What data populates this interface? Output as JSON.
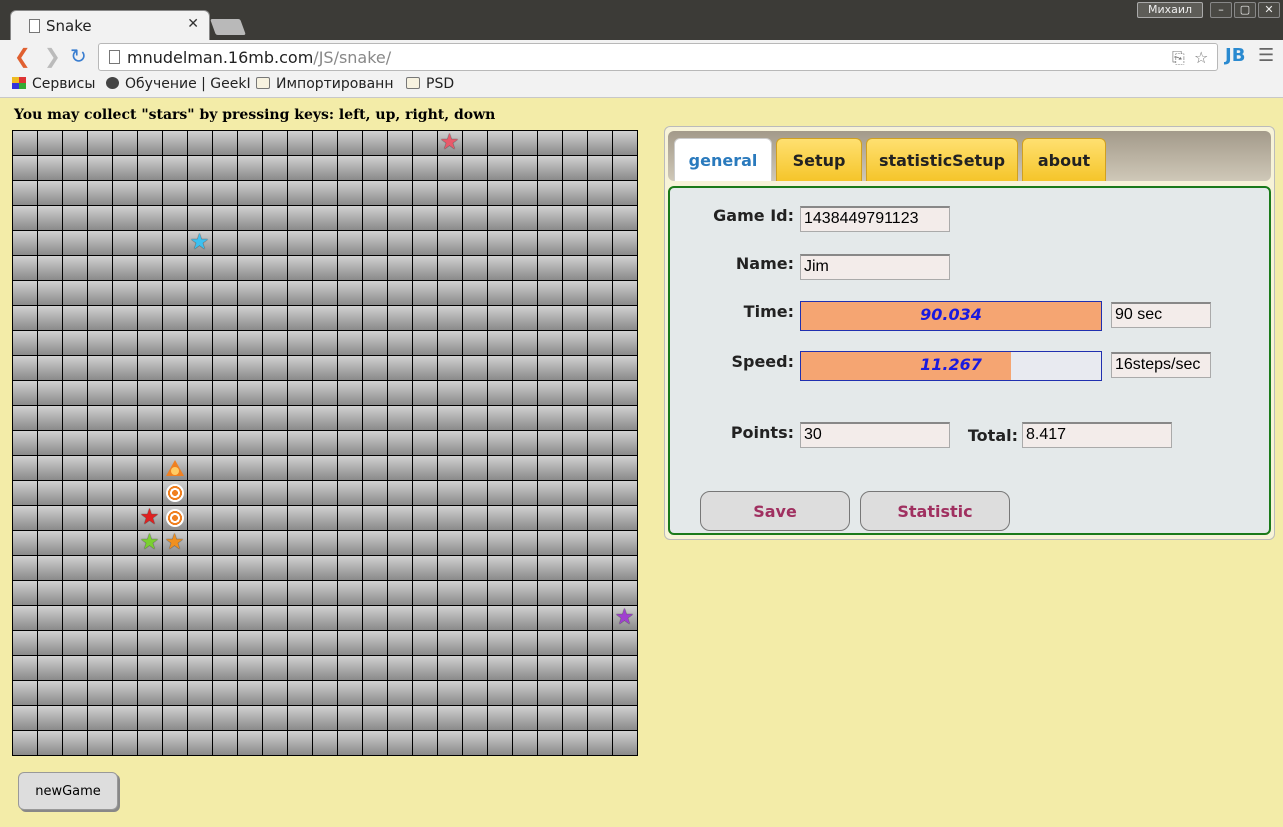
{
  "browser": {
    "tab_title": "Snake",
    "user_label": "Михаил",
    "url_host": "mnudelman.16mb.com",
    "url_path": "/JS/snake/",
    "bookmarks": [
      {
        "label": "Сервисы",
        "icon": "apps-grid-icon"
      },
      {
        "label": "Обучение | GeekI",
        "icon": "geekbrains-icon"
      },
      {
        "label": "Импортированн",
        "icon": "folder-icon"
      },
      {
        "label": "PSD",
        "icon": "folder-icon"
      }
    ]
  },
  "page": {
    "instructions": "You may collect \"stars\" by pressing keys: left, up, right, down",
    "newgame_label": "newGame"
  },
  "panel": {
    "tabs": [
      {
        "label": "general",
        "active": true
      },
      {
        "label": "Setup",
        "active": false
      },
      {
        "label": "statisticSetup",
        "active": false
      },
      {
        "label": "about",
        "active": false
      }
    ],
    "fields": {
      "game_id_label": "Game Id:",
      "game_id_value": "1438449791123",
      "name_label": "Name:",
      "name_value": "Jim",
      "time_label": "Time:",
      "time_progress": "90.034",
      "time_progress_fraction": 1.0,
      "time_value": "90 sec",
      "speed_label": "Speed:",
      "speed_progress": "11.267",
      "speed_progress_fraction": 0.7,
      "speed_value": "16steps/sec",
      "points_label": "Points:",
      "points_value": "30",
      "total_label": "Total:",
      "total_value": "8.417"
    },
    "save_label": "Save",
    "statistic_label": "Statistic"
  },
  "colors": {
    "page_bg": "#f3eca8",
    "tab_active_text": "#2a7abd",
    "tab_bg": "#f5c52a",
    "progress_fill": "#f5a572",
    "progress_text": "#1a1adf",
    "button_text": "#a03060",
    "content_border": "#1a7a1a"
  },
  "board": {
    "grid_size": 25,
    "items": [
      {
        "kind": "star",
        "color": "#e85a6a",
        "col": 17,
        "row": 0
      },
      {
        "kind": "star",
        "color": "#3cc0f0",
        "col": 7,
        "row": 4
      },
      {
        "kind": "snake-head",
        "col": 6,
        "row": 13
      },
      {
        "kind": "snake-segment",
        "col": 6,
        "row": 14
      },
      {
        "kind": "snake-segment",
        "col": 6,
        "row": 15
      },
      {
        "kind": "star",
        "color": "#e02020",
        "col": 5,
        "row": 15
      },
      {
        "kind": "star",
        "color": "#7ad030",
        "col": 5,
        "row": 16
      },
      {
        "kind": "star",
        "color": "#f09020",
        "col": 6,
        "row": 16
      },
      {
        "kind": "star",
        "color": "#a040d0",
        "col": 24,
        "row": 19
      }
    ]
  }
}
